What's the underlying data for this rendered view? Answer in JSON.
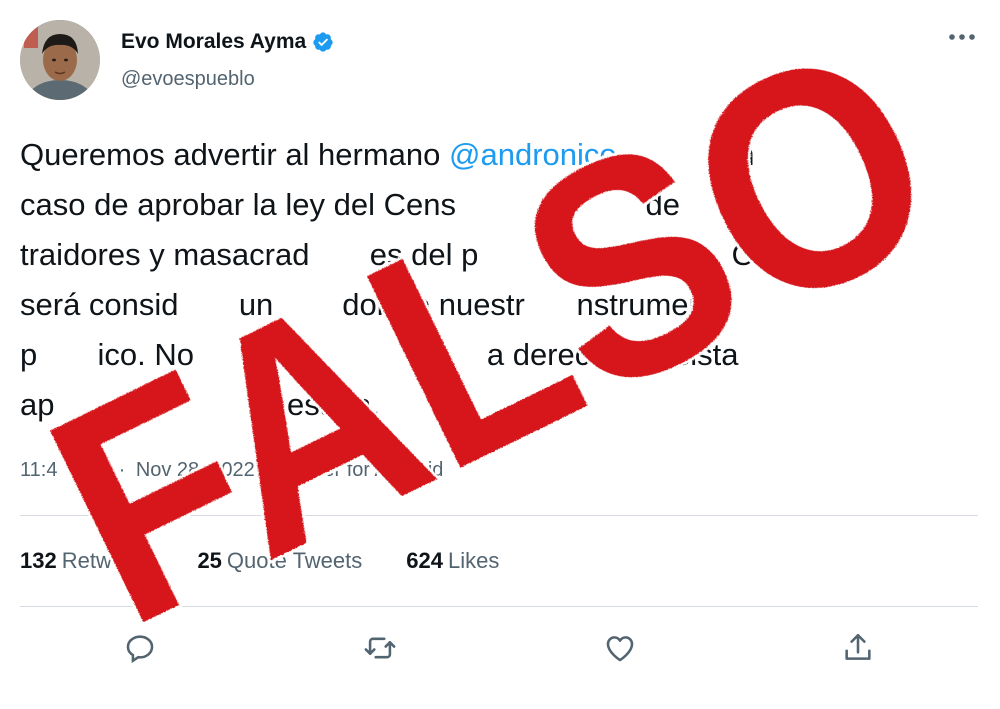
{
  "author": {
    "display_name": "Evo Morales Ayma",
    "handle": "@evoespueblo",
    "verified": true
  },
  "icons": {
    "more": "more-dots-icon",
    "verified": "verified-badge-icon",
    "reply": "reply-icon",
    "retweet": "retweet-icon",
    "like": "like-icon",
    "share": "share-icon"
  },
  "tweet": {
    "lines": [
      {
        "pre": "Queremos advertir al hermano ",
        "mention": "@andronico",
        "post": "            en"
      },
      {
        "text": "caso de aprobar la ley del Cens                      de"
      },
      {
        "text": "traidores y masacrad       es del p                  Sa       Cr"
      },
      {
        "text": "será consid       un        dor de nuestr      nstrumento"
      },
      {
        "text": "p       ico. No                                  a derecha fascista"
      },
      {
        "text": "ap          ur            cesaria."
      }
    ]
  },
  "meta": {
    "time": "11:4",
    "date": "Nov 28, 2022",
    "separator": "·",
    "source": "Twitter for Android"
  },
  "stats": [
    {
      "count": "132",
      "label": "Retweets"
    },
    {
      "count": "25",
      "label": "Quote Tweets"
    },
    {
      "count": "624",
      "label": "Likes"
    }
  ],
  "overlay": {
    "stamp_text": "FALSO",
    "color": "#d7141a"
  },
  "colors": {
    "text": "#0f1419",
    "secondary": "#536471",
    "link": "#1d9bf0",
    "divider": "#d5dbe0"
  }
}
